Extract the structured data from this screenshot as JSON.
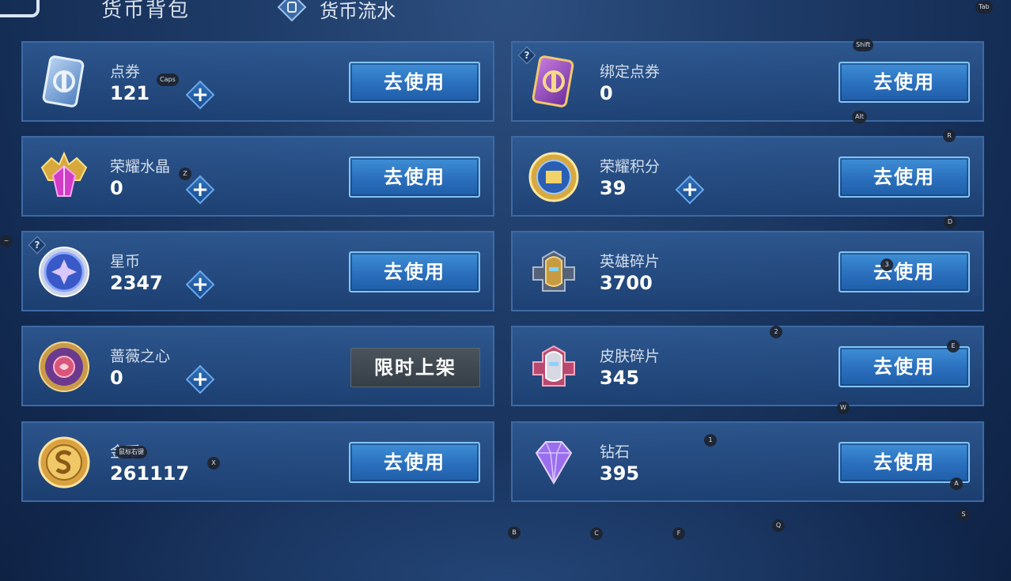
{
  "header": {
    "title": "货币背包",
    "tab": "货币流水"
  },
  "currencies": [
    {
      "name": "点券",
      "amount": "121",
      "action": "去使用",
      "icon": "coupon-card-icon"
    },
    {
      "name": "绑定点券",
      "amount": "0",
      "action": "去使用",
      "icon": "bound-coupon-card-icon"
    },
    {
      "name": "荣耀水晶",
      "amount": "0",
      "action": "去使用",
      "icon": "glory-crystal-icon"
    },
    {
      "name": "荣耀积分",
      "amount": "39",
      "action": "去使用",
      "icon": "glory-points-icon"
    },
    {
      "name": "星币",
      "amount": "2347",
      "action": "去使用",
      "icon": "star-coin-icon"
    },
    {
      "name": "英雄碎片",
      "amount": "3700",
      "action": "去使用",
      "icon": "hero-fragment-icon"
    },
    {
      "name": "蔷薇之心",
      "amount": "0",
      "action": "限时上架",
      "icon": "rose-heart-icon"
    },
    {
      "name": "皮肤碎片",
      "amount": "345",
      "action": "去使用",
      "icon": "skin-fragment-icon"
    },
    {
      "name": "金币",
      "amount": "261117",
      "action": "去使用",
      "icon": "gold-coin-icon"
    },
    {
      "name": "钻石",
      "amount": "395",
      "action": "去使用",
      "icon": "diamond-icon"
    }
  ],
  "plus_symbol": "+",
  "help_symbol": "?",
  "key_hints": {
    "tab": "Tab",
    "shift": "Shift",
    "caps": "Caps",
    "alt": "Alt",
    "r": "R",
    "z": "Z",
    "tilde": "~",
    "d": "D",
    "three": "3",
    "two": "2",
    "e": "E",
    "w": "W",
    "one": "1",
    "x": "X",
    "right_click": "鼠标右键",
    "a": "A",
    "s": "S",
    "b": "B",
    "c": "C",
    "f": "F",
    "q": "Q"
  }
}
